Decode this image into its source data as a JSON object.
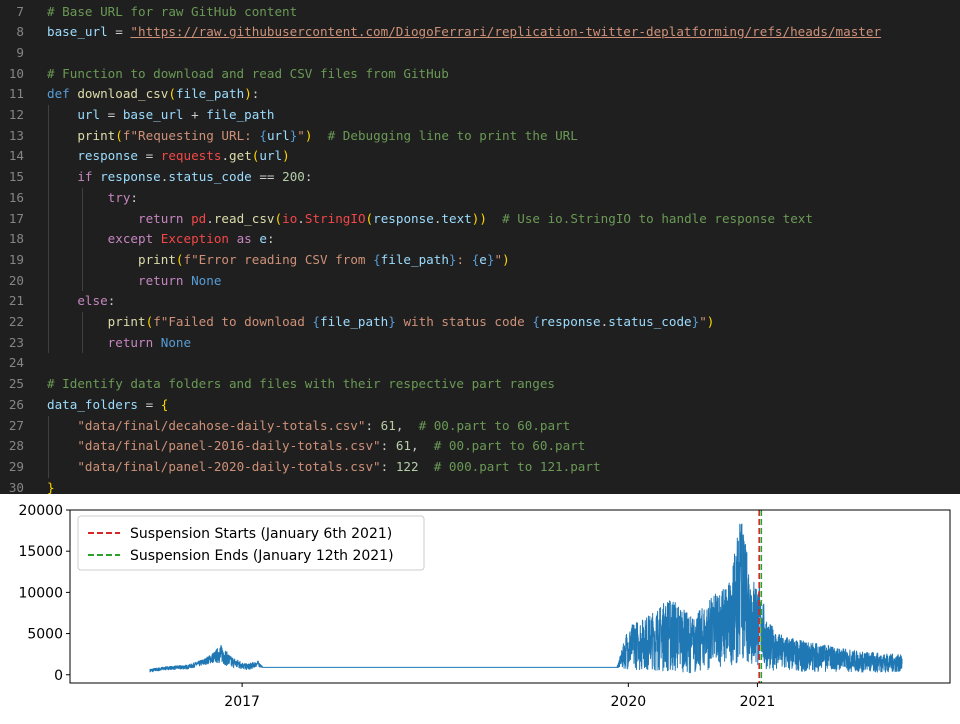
{
  "editor": {
    "lines": [
      {
        "n": "7",
        "t": [
          [
            "cmt",
            "# Base URL for raw GitHub content"
          ]
        ]
      },
      {
        "n": "8",
        "t": [
          [
            "var",
            "base_url"
          ],
          [
            "op",
            " = "
          ],
          [
            "url",
            "\"https://raw.githubusercontent.com/DiogoFerrari/replication-twitter-deplatforming/refs/heads/master"
          ]
        ]
      },
      {
        "n": "9",
        "t": []
      },
      {
        "n": "10",
        "t": [
          [
            "cmt",
            "# Function to download and read CSV files from GitHub"
          ]
        ]
      },
      {
        "n": "11",
        "t": [
          [
            "ph",
            "def "
          ],
          [
            "fn",
            "download_csv"
          ],
          [
            "brk",
            "("
          ],
          [
            "var",
            "file_path"
          ],
          [
            "brk",
            ")"
          ],
          [
            "op",
            ":"
          ]
        ]
      },
      {
        "n": "12",
        "t": [
          [
            "op",
            "    "
          ],
          [
            "var",
            "url"
          ],
          [
            "op",
            " = "
          ],
          [
            "var",
            "base_url"
          ],
          [
            "op",
            " + "
          ],
          [
            "var",
            "file_path"
          ]
        ]
      },
      {
        "n": "13",
        "t": [
          [
            "op",
            "    "
          ],
          [
            "fn",
            "print"
          ],
          [
            "brk",
            "("
          ],
          [
            "str",
            "f\"Requesting URL: "
          ],
          [
            "ph",
            "{"
          ],
          [
            "var",
            "url"
          ],
          [
            "ph",
            "}"
          ],
          [
            "str",
            "\""
          ],
          [
            "brk",
            ")"
          ],
          [
            "op",
            "  "
          ],
          [
            "cmt",
            "# Debugging line to print the URL"
          ]
        ]
      },
      {
        "n": "14",
        "t": [
          [
            "op",
            "    "
          ],
          [
            "var",
            "response"
          ],
          [
            "op",
            " = "
          ],
          [
            "err",
            "requests"
          ],
          [
            "op",
            "."
          ],
          [
            "fn",
            "get"
          ],
          [
            "brk",
            "("
          ],
          [
            "var",
            "url"
          ],
          [
            "brk",
            ")"
          ]
        ]
      },
      {
        "n": "15",
        "t": [
          [
            "op",
            "    "
          ],
          [
            "kw",
            "if "
          ],
          [
            "var",
            "response"
          ],
          [
            "op",
            "."
          ],
          [
            "var",
            "status_code"
          ],
          [
            "op",
            " == "
          ],
          [
            "num",
            "200"
          ],
          [
            "op",
            ":"
          ]
        ]
      },
      {
        "n": "16",
        "t": [
          [
            "op",
            "        "
          ],
          [
            "kw",
            "try"
          ],
          [
            "op",
            ":"
          ]
        ]
      },
      {
        "n": "17",
        "t": [
          [
            "op",
            "            "
          ],
          [
            "kw",
            "return "
          ],
          [
            "err",
            "pd"
          ],
          [
            "op",
            "."
          ],
          [
            "fn",
            "read_csv"
          ],
          [
            "brk",
            "("
          ],
          [
            "err",
            "io"
          ],
          [
            "op",
            "."
          ],
          [
            "err",
            "StringIO"
          ],
          [
            "brk",
            "("
          ],
          [
            "var",
            "response"
          ],
          [
            "op",
            "."
          ],
          [
            "var",
            "text"
          ],
          [
            "brk",
            "))"
          ],
          [
            "op",
            "  "
          ],
          [
            "cmt",
            "# Use io.StringIO to handle response text"
          ]
        ]
      },
      {
        "n": "18",
        "t": [
          [
            "op",
            "        "
          ],
          [
            "kw",
            "except "
          ],
          [
            "err",
            "Exception"
          ],
          [
            "kw",
            " as "
          ],
          [
            "var",
            "e"
          ],
          [
            "op",
            ":"
          ]
        ]
      },
      {
        "n": "19",
        "t": [
          [
            "op",
            "            "
          ],
          [
            "fn",
            "print"
          ],
          [
            "brk",
            "("
          ],
          [
            "str",
            "f\"Error reading CSV from "
          ],
          [
            "ph",
            "{"
          ],
          [
            "var",
            "file_path"
          ],
          [
            "ph",
            "}"
          ],
          [
            "str",
            ": "
          ],
          [
            "ph",
            "{"
          ],
          [
            "var",
            "e"
          ],
          [
            "ph",
            "}"
          ],
          [
            "str",
            "\""
          ],
          [
            "brk",
            ")"
          ]
        ]
      },
      {
        "n": "20",
        "t": [
          [
            "op",
            "            "
          ],
          [
            "kw",
            "return "
          ],
          [
            "const",
            "None"
          ]
        ]
      },
      {
        "n": "21",
        "t": [
          [
            "op",
            "    "
          ],
          [
            "kw",
            "else"
          ],
          [
            "op",
            ":"
          ]
        ]
      },
      {
        "n": "22",
        "t": [
          [
            "op",
            "        "
          ],
          [
            "fn",
            "print"
          ],
          [
            "brk",
            "("
          ],
          [
            "str",
            "f\"Failed to download "
          ],
          [
            "ph",
            "{"
          ],
          [
            "var",
            "file_path"
          ],
          [
            "ph",
            "}"
          ],
          [
            "str",
            " with status code "
          ],
          [
            "ph",
            "{"
          ],
          [
            "var",
            "response"
          ],
          [
            "op",
            "."
          ],
          [
            "var",
            "status_code"
          ],
          [
            "ph",
            "}"
          ],
          [
            "str",
            "\""
          ],
          [
            "brk",
            ")"
          ]
        ]
      },
      {
        "n": "23",
        "t": [
          [
            "op",
            "        "
          ],
          [
            "kw",
            "return "
          ],
          [
            "const",
            "None"
          ]
        ]
      },
      {
        "n": "24",
        "t": []
      },
      {
        "n": "25",
        "t": [
          [
            "cmt",
            "# Identify data folders and files with their respective part ranges"
          ]
        ]
      },
      {
        "n": "26",
        "t": [
          [
            "var",
            "data_folders"
          ],
          [
            "op",
            " = "
          ],
          [
            "brk",
            "{"
          ]
        ]
      },
      {
        "n": "27",
        "t": [
          [
            "op",
            "    "
          ],
          [
            "str",
            "\"data/final/decahose-daily-totals.csv\""
          ],
          [
            "op",
            ": "
          ],
          [
            "num",
            "61"
          ],
          [
            "op",
            ",  "
          ],
          [
            "cmt",
            "# 00.part to 60.part"
          ]
        ]
      },
      {
        "n": "28",
        "t": [
          [
            "op",
            "    "
          ],
          [
            "str",
            "\"data/final/panel-2016-daily-totals.csv\""
          ],
          [
            "op",
            ": "
          ],
          [
            "num",
            "61"
          ],
          [
            "op",
            ",  "
          ],
          [
            "cmt",
            "# 00.part to 60.part"
          ]
        ]
      },
      {
        "n": "29",
        "t": [
          [
            "op",
            "    "
          ],
          [
            "str",
            "\"data/final/panel-2020-daily-totals.csv\""
          ],
          [
            "op",
            ": "
          ],
          [
            "num",
            "122"
          ],
          [
            "op",
            "  "
          ],
          [
            "cmt",
            "# 000.part to 121.part"
          ]
        ]
      },
      {
        "n": "30",
        "t": [
          [
            "brk",
            "}"
          ]
        ]
      }
    ]
  },
  "chart_data": {
    "type": "line",
    "x_type": "date",
    "xlim": [
      "2015-09-01",
      "2022-07-01"
    ],
    "ylim": [
      -1000,
      20000
    ],
    "y_ticks": [
      0,
      5000,
      10000,
      15000,
      20000
    ],
    "y_tick_labels": [
      "0",
      "5000",
      "10000",
      "15000",
      "20000"
    ],
    "x_ticks": [
      "2017-01-01",
      "2020-01-01",
      "2021-01-01"
    ],
    "x_tick_labels": [
      "2017",
      "2020",
      "2021"
    ],
    "grid": false,
    "legend_position": "upper-left",
    "line_color": "#1f77b4",
    "series": [
      {
        "x": [
          "2016-04-15",
          "2016-06-01",
          "2016-08-01",
          "2016-09-15",
          "2016-10-15",
          "2016-11-01",
          "2016-12-01",
          "2017-01-15",
          "2017-02-15",
          "2017-03-01",
          "2019-11-30",
          "2020-01-01",
          "2020-03-01",
          "2020-05-01",
          "2020-07-01",
          "2020-08-01",
          "2020-09-01",
          "2020-10-15",
          "2020-11-15",
          "2020-12-15",
          "2021-01-06",
          "2021-02-01",
          "2021-03-01",
          "2021-05-01",
          "2021-07-01",
          "2021-09-01",
          "2021-11-01",
          "2022-01-01",
          "2022-02-15"
        ],
        "y_low": [
          300,
          600,
          700,
          1200,
          1500,
          1400,
          900,
          600,
          900,
          900,
          900,
          700,
          500,
          400,
          200,
          500,
          800,
          1200,
          1300,
          1200,
          1000,
          600,
          500,
          400,
          400,
          400,
          300,
          300,
          400
        ],
        "y_high": [
          700,
          1000,
          1200,
          1900,
          2800,
          3700,
          2200,
          1300,
          1700,
          900,
          900,
          6000,
          7300,
          9500,
          7000,
          8300,
          9800,
          11500,
          19000,
          12000,
          11000,
          6500,
          5000,
          4200,
          3800,
          3200,
          2800,
          2600,
          2400
        ]
      }
    ],
    "vlines": [
      {
        "x": "2021-01-06",
        "color": "#d62728",
        "style": "dashed",
        "label": "Suspension Starts (January 6th 2021)"
      },
      {
        "x": "2021-01-12",
        "color": "#2ca02c",
        "style": "dashed",
        "label": "Suspension Ends (January 12th 2021)"
      }
    ]
  }
}
